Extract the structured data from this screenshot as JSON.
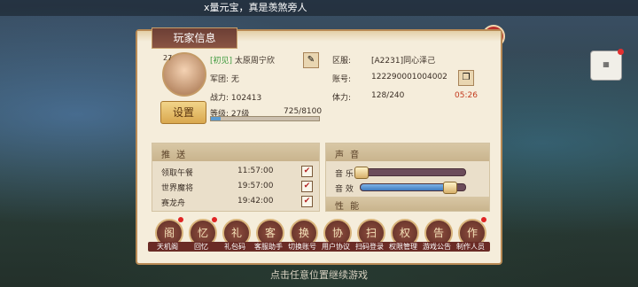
{
  "ticker_text": "x量元宝，真是羡煞旁人",
  "bottom_hint": "点击任意位置继续游戏",
  "panel": {
    "title": "玩家信息",
    "close_icon": "close-icon",
    "player": {
      "avatar_level": "27",
      "tag": "[初见]",
      "name": "太原周宁欣",
      "guild_label": "军团: 无",
      "power_label": "战力: 102413",
      "level_label": "等级: 27级",
      "xp_text": "725/8100",
      "xp_fraction": 0.0895,
      "settings_label": "设置"
    },
    "account": {
      "server_label": "区服:",
      "server_value": "[A2231]同心泽己",
      "account_label": "账号:",
      "account_value": "122290001004002",
      "stamina_label": "体力:",
      "stamina_value": "128/240",
      "stamina_timer": "05:26"
    },
    "push": {
      "title": "推 送",
      "items": [
        {
          "name": "领取午餐",
          "time": "11:57:00",
          "checked": "✔"
        },
        {
          "name": "世界魔将",
          "time": "19:57:00",
          "checked": "✔"
        },
        {
          "name": "赛龙舟",
          "time": "19:42:00",
          "checked": "✔"
        }
      ]
    },
    "sound": {
      "title": "声 音",
      "music_label": "音 乐",
      "music_level": 0.0,
      "sfx_label": "音 效",
      "sfx_level": 0.85,
      "performance_title": "性 能"
    },
    "actions": [
      {
        "label": "天机阁",
        "glyph": "阁",
        "badge": true
      },
      {
        "label": "回忆",
        "glyph": "忆",
        "badge": true
      },
      {
        "label": "礼包码",
        "glyph": "礼",
        "badge": false
      },
      {
        "label": "客服助手",
        "glyph": "客",
        "badge": false
      },
      {
        "label": "切换账号",
        "glyph": "换",
        "badge": false
      },
      {
        "label": "用户协议",
        "glyph": "协",
        "badge": false
      },
      {
        "label": "扫码登录",
        "glyph": "扫",
        "badge": false
      },
      {
        "label": "权限管理",
        "glyph": "权",
        "badge": false
      },
      {
        "label": "游戏公告",
        "glyph": "告",
        "badge": false
      },
      {
        "label": "制作人员",
        "glyph": "作",
        "badge": true
      }
    ]
  }
}
